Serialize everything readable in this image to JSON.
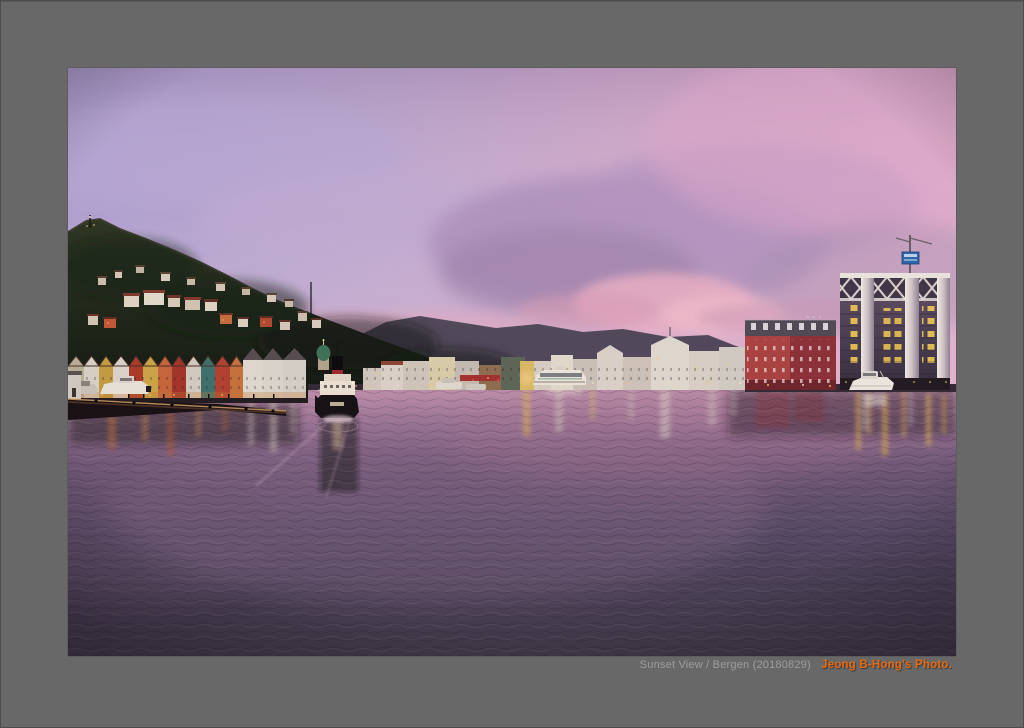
{
  "caption": {
    "title": "Sunset View / Bergen (20180829)",
    "credit": "Jeong B-Hong's Photo.",
    "title_color": "#9d9d9d",
    "credit_color": "#e8690f"
  },
  "frame": {
    "color": "#686868"
  },
  "scene": {
    "description": "Sunset over Bergen harbour: pink and purple sky with soft clouds, forested mountain with hillside houses on the left, Bryggen gabled wharf houses, waterfront city buildings, a red brick hotel and a modern glass building with a construction crane on the right, a ferry approaching in the centre, moored boats, and calm dark water full of reflections with a pier in the lower left",
    "landmarks": [
      "mountain",
      "hillside-houses",
      "bryggen-gabled-houses",
      "green-dome-tower",
      "center-ferry",
      "catamaran-ferry",
      "red-hotel",
      "modern-glass-building",
      "construction-crane",
      "motor-yacht",
      "foreground-pier"
    ],
    "palette": {
      "sky_left": "#afa0cf",
      "sky_right": "#e0afca",
      "cloud_pink": "#e9aec2",
      "mountain": "#2a3120",
      "water_top": "#aa7e96",
      "water_bottom": "#3f3847"
    }
  }
}
